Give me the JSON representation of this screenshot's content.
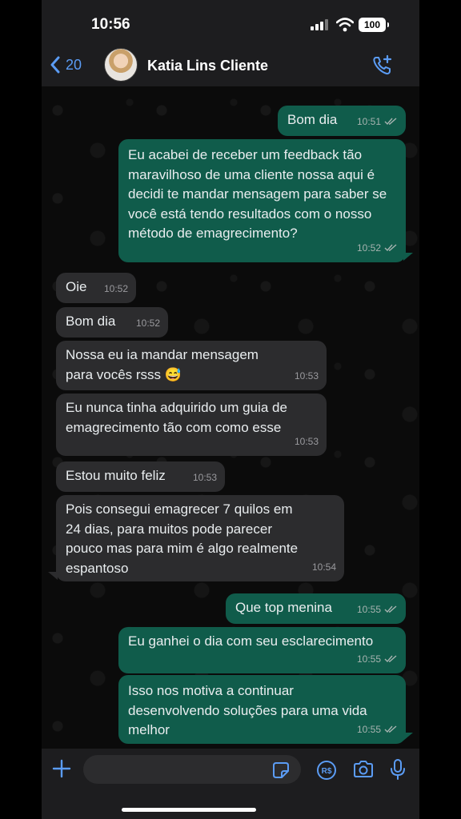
{
  "status_bar": {
    "time": "10:56",
    "battery": "100"
  },
  "header": {
    "back_count": "20",
    "contact_name": "Katia Lins Cliente"
  },
  "messages": [
    {
      "direction": "out",
      "text": "Bom dia",
      "time": "10:51"
    },
    {
      "direction": "out",
      "text": "Eu acabei de receber um feedback tão maravilhoso de uma cliente nossa aqui é decidi te mandar mensagem para saber se você está tendo resultados com o nosso método de emagrecimento?",
      "time": "10:52"
    },
    {
      "direction": "in",
      "text": "Oie",
      "time": "10:52"
    },
    {
      "direction": "in",
      "text": "Bom dia",
      "time": "10:52"
    },
    {
      "direction": "in",
      "text": "Nossa eu ia mandar mensagem para vocês rsss 😅",
      "time": "10:53"
    },
    {
      "direction": "in",
      "text": "Eu nunca tinha adquirido um guia de emagrecimento tão com como esse",
      "time": "10:53"
    },
    {
      "direction": "in",
      "text": "Estou muito feliz",
      "time": "10:53"
    },
    {
      "direction": "in",
      "text": "Pois consegui emagrecer 7 quilos em 24 dias, para muitos pode parecer pouco mas para mim é algo realmente espantoso",
      "time": "10:54"
    },
    {
      "direction": "out",
      "text": "Que top menina",
      "time": "10:55"
    },
    {
      "direction": "out",
      "text": "Eu ganhei o dia com seu esclarecimento",
      "time": "10:55"
    },
    {
      "direction": "out",
      "text": "Isso nos motiva a continuar desenvolvendo soluções para uma vida melhor",
      "time": "10:55"
    }
  ],
  "colors": {
    "outgoing_bubble": "#105c4b",
    "incoming_bubble": "#2c2c2e",
    "accent_blue": "#5b9cf4"
  },
  "icons": {
    "back": "chevron-left-icon",
    "call": "add-call-icon",
    "plus": "plus-icon",
    "sticker": "sticker-icon",
    "pay": "payment-icon",
    "camera": "camera-icon",
    "mic": "microphone-icon"
  }
}
